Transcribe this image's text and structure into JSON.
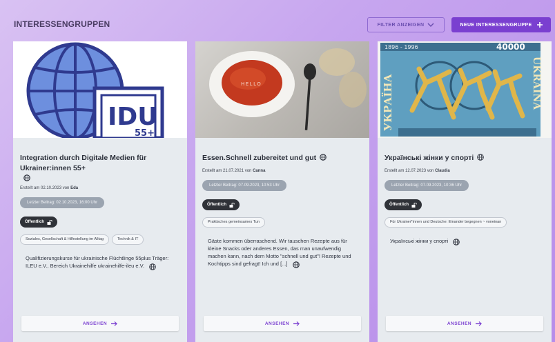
{
  "page": {
    "title": "INTERESSENGRUPPEN"
  },
  "toolbar": {
    "filter_label": "FILTER ANZEIGEN",
    "new_label": "NEUE INTERESSENGRUPPE"
  },
  "colors": {
    "accent": "#7a3fd0",
    "card_bg": "#e7ebef",
    "badge_dark": "#2f3238",
    "badge_grey": "#9ba4b0"
  },
  "cards": [
    {
      "title": "Integration durch Digitale Medien für Ukrainer:innen 55+",
      "image": "idu-globe-logo",
      "image_text": {
        "logo": "IDU",
        "sub": "55+"
      },
      "created_prefix": "Erstellt am 02.10.2023 von",
      "author": "Eda",
      "last_post": "Letzter Beitrag: 02.10.2023, 16:00 Uhr",
      "visibility": "Öffentlich",
      "tags": [
        "Soziales, Gesellschaft & Hilfestellung im Alltag",
        "Technik & IT"
      ],
      "description": "Qualifizierungskurse für ukrainische Flüchtlinge 55plus  Träger: ILEU e.V., Bereich Ukrainehilfe ukrainehilfe-ileu e.V.",
      "view_label": "ANSEHEN"
    },
    {
      "title": "Essen.Schnell zubereitet und gut",
      "image": "tomato-soup-bowl-photo",
      "image_text": {
        "bowl": "HELLO"
      },
      "created_prefix": "Erstellt am 21.07.2021 von",
      "author": "Canna",
      "last_post": "Letzter Beitrag: 07.09.2023, 10:53 Uhr",
      "visibility": "Öffentlich",
      "tags": [
        "Praktisches gemeinsames Tun"
      ],
      "description": "Gäste kommen überraschend. Wir tauschen Rezepte aus für kleine Snacks oder anderes Essen, das man unaufwendig machen kann, nach dem Motto \"schnell und gut\"! Rezepte und Kochtipps sind gefragt! Ich und [...]",
      "view_label": "ANSEHEN"
    },
    {
      "title": "Українські жінки у спорті",
      "image": "ukraine-stamp-runners",
      "image_text": {
        "years": "1896 - 1996",
        "value": "40000",
        "left": "УКРАЇНА",
        "right": "UKRAINA"
      },
      "created_prefix": "Erstellt am 12.07.2023 von",
      "author": "Claudia",
      "last_post": "Letzter Beitrag: 07.09.2023, 10:36 Uhr",
      "visibility": "Öffentlich",
      "tags": [
        "Für Ukrainer*innen und Deutsche: Einander begegnen ~ voneinan"
      ],
      "description": "Українські жінки у спорті",
      "view_label": "ANSEHEN"
    }
  ]
}
